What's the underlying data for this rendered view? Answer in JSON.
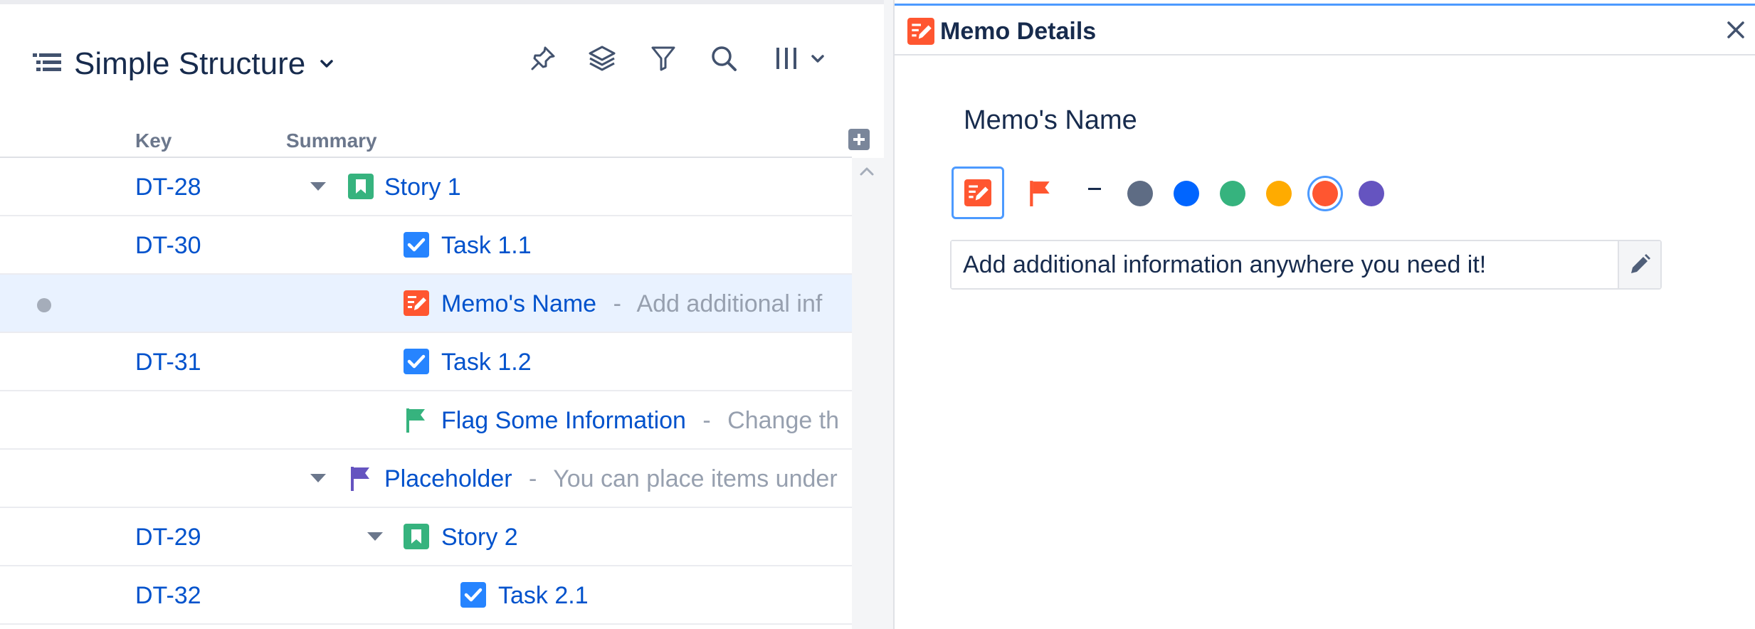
{
  "structure": {
    "title": "Simple Structure",
    "toolbar": [
      "pin-icon",
      "layers-icon",
      "filter-icon",
      "search-icon",
      "columns-icon"
    ],
    "columns": {
      "key": "Key",
      "summary": "Summary"
    },
    "rows": [
      {
        "key": "DT-28",
        "summary": "Story 1",
        "description": "",
        "icon": "story-icon",
        "expanded": true
      },
      {
        "key": "DT-30",
        "summary": "Task 1.1",
        "description": "",
        "icon": "task-icon"
      },
      {
        "key": "",
        "summary": "Memo's Name",
        "description": "Add additional inf",
        "icon": "memo-icon",
        "selected": true
      },
      {
        "key": "DT-31",
        "summary": "Task 1.2",
        "description": "",
        "icon": "task-icon"
      },
      {
        "key": "",
        "summary": "Flag Some Information",
        "description": "Change th",
        "icon": "flag-icon"
      },
      {
        "key": "",
        "summary": "Placeholder",
        "description": "You can place items under",
        "icon": "placeholder-flag-icon",
        "expanded": true
      },
      {
        "key": "DT-29",
        "summary": "Story 2",
        "description": "",
        "icon": "story-icon",
        "expanded": true
      },
      {
        "key": "DT-32",
        "summary": "Task 2.1",
        "description": "",
        "icon": "task-icon"
      }
    ],
    "separator": "-"
  },
  "details": {
    "title": "Memo Details",
    "memo_name": "Memo's Name",
    "icon_choices": [
      "memo-icon",
      "flag-icon"
    ],
    "selected_icon": "memo-icon",
    "no_color_label": "–",
    "colors": [
      "#5e6c84",
      "#0065ff",
      "#36b37e",
      "#ffab00",
      "#ff5630",
      "#6554c0"
    ],
    "selected_color": "#ff5630",
    "description_value": "Add additional information anywhere you need it!"
  },
  "theme": {
    "link_blue": "#0052cc",
    "story_green": "#36b37e",
    "task_blue": "#2684ff",
    "memo_red": "#ff5630",
    "placeholder_purple": "#6554c0"
  }
}
